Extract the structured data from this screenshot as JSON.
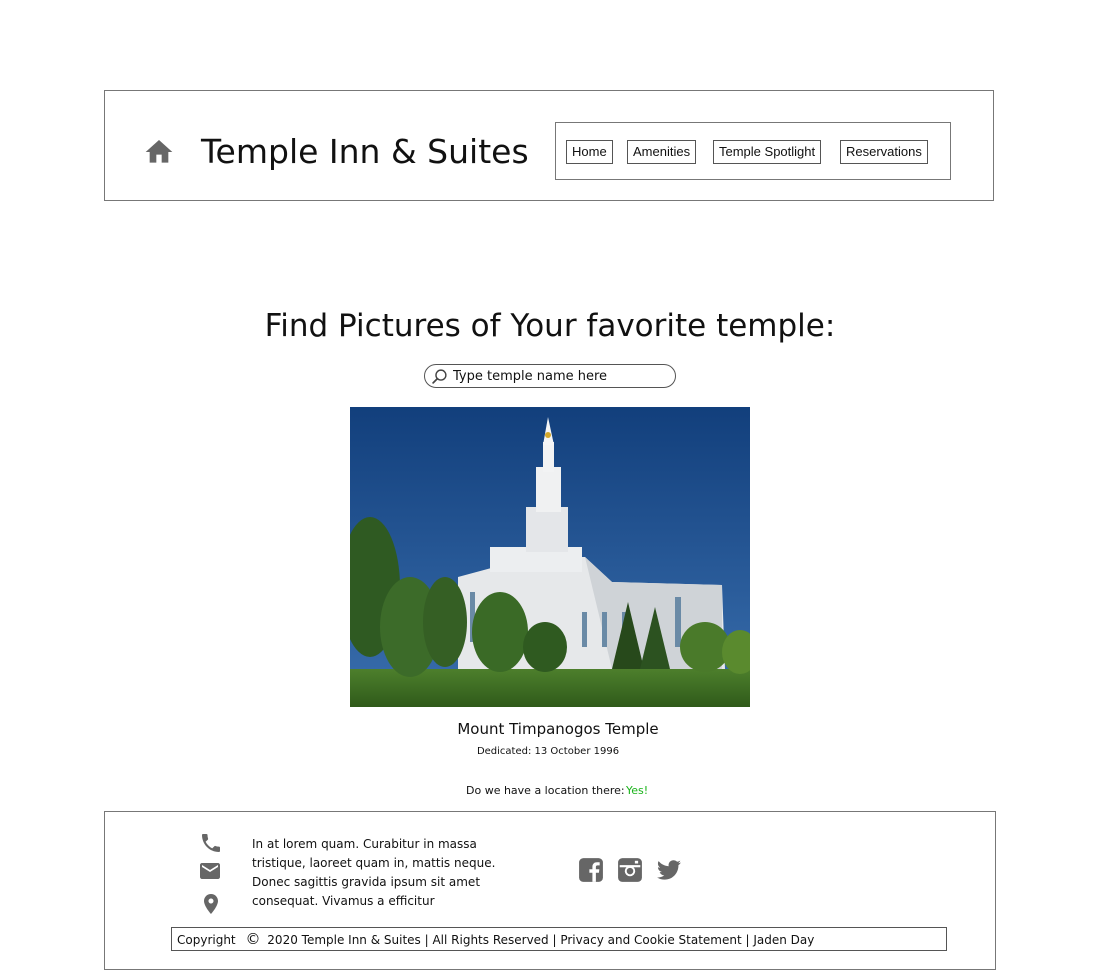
{
  "header": {
    "title": "Temple Inn & Suites",
    "nav": [
      "Home",
      "Amenities",
      "Temple Spotlight",
      "Reservations"
    ]
  },
  "main": {
    "heading": "Find Pictures of Your favorite temple:",
    "search_placeholder": "Type temple name here",
    "temple_name": "Mount Timpanogos Temple",
    "dedicated": "Dedicated: 13 October 1996",
    "location_question": "Do we have a location there:",
    "location_answer": "Yes!"
  },
  "footer": {
    "text": "In at lorem quam. Curabitur in massa tristique, laoreet quam in, mattis neque. Donec sagittis gravida ipsum sit amet consequat. Vivamus a efficitur",
    "copyright_prefix": "Copyright",
    "copyright_symbol": "©",
    "copyright_text": "2020 Temple Inn & Suites | All Rights Reserved | Privacy and Cookie Statement | Jaden Day"
  },
  "icons": {
    "header": "home-icon",
    "contact": [
      "phone-icon",
      "mail-icon",
      "map-pin-icon"
    ],
    "social": [
      "facebook-icon",
      "instagram-icon",
      "twitter-icon"
    ]
  },
  "colors": {
    "icon_gray": "#666666",
    "success_green": "#19b319",
    "sky_blue": "#1c4a86",
    "lawn_green": "#4a7a2a"
  }
}
